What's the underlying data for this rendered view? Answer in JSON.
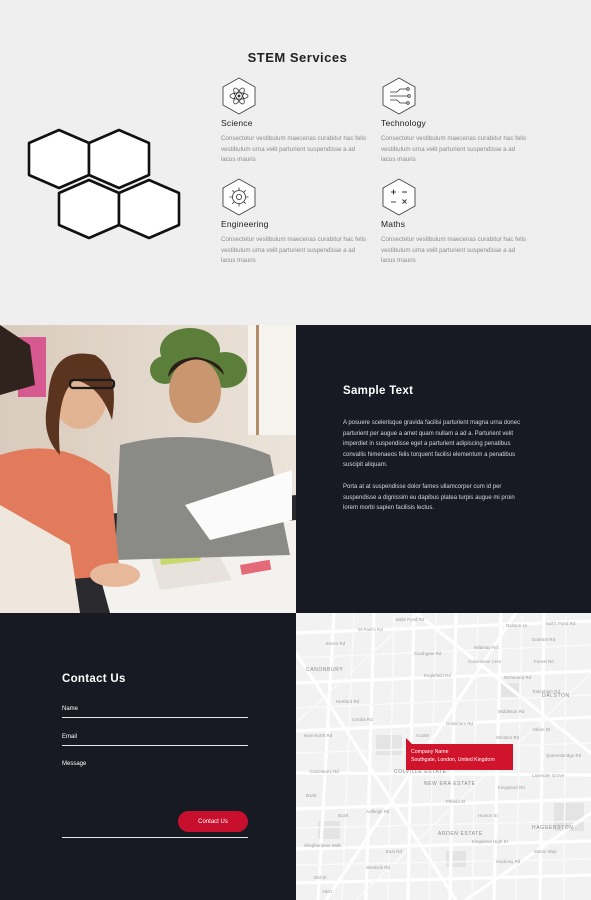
{
  "stem": {
    "title": "STEM Services",
    "services": [
      {
        "name": "Science",
        "icon": "atom-icon",
        "desc": "Consectetur vestibulum maecenas curabitur hac felis vestibulum urna velit parturient suspendisse a ad lacus mauris"
      },
      {
        "name": "Technology",
        "icon": "circuit-icon",
        "desc": "Consectetur vestibulum maecenas curabitur hac felis vestibulum urna velit parturient suspendisse a ad lacus mauris"
      },
      {
        "name": "Engineering",
        "icon": "gear-icon",
        "desc": "Consectetur vestibulum maecenas curabitur hac felis vestibulum urna velit parturient suspendisse a ad lacus mauris"
      },
      {
        "name": "Maths",
        "icon": "math-symbols-icon",
        "desc": "Consectetur vestibulum maecenas curabitur hac felis vestibulum urna velit parturient suspendisse a ad lacus mauris"
      }
    ]
  },
  "sample": {
    "title": "Sample Text",
    "paragraph1": "A posuere scelerisque gravida facilisi parturient magna urna donec parturient per augue a amet quam nullam a ad a. Parturient velit imperdiet in suspendisse eget a parturient adipiscing penatibus convallis himenaeos felis torquent facilisi elementum a penatibus suscipit aliquam.",
    "paragraph2": "Porta at at suspendisse dolor fames ullamcorper cum id per suspendisse a dignissim eu dapibus platea turpis augue mi proin lorem morbi sapien facilisis lectus."
  },
  "contact": {
    "title": "Contact Us",
    "name_label": "Name",
    "email_label": "Email",
    "message_label": "Message",
    "submit_label": "Contact Us"
  },
  "map": {
    "company_name": "Company Name",
    "company_address": "Southgate, London, United Kingdom",
    "areas": [
      "CANONBURY",
      "DALSTON",
      "COLVILLE ESTATE",
      "NEW ERA ESTATE",
      "HAGGERSTON",
      "ARDEN ESTATE"
    ],
    "streets": [
      "Balls Pond Rd",
      "Dalston Ln",
      "Essex Rd",
      "Englefield Rd",
      "Southgate Rd",
      "Downham Rd",
      "Kingsland Rd",
      "Richmond Rd",
      "Hertford Rd",
      "Middleton Rd",
      "Albion Dr",
      "Whiston Rd",
      "Hoxton St",
      "New North Rd",
      "Pitfield St",
      "East Rd",
      "Queensbridge Rd",
      "Forest Rd",
      "Lavender Grove",
      "Graham Rd",
      "Mildmay Rd",
      "Ardleigh Rd",
      "Canonbury Rd",
      "Colvestone Cres",
      "St Paul's Rd",
      "Hackney Rd",
      "Shepherdess Walk",
      "Wenlock Rd",
      "Old St",
      "B144",
      "A1209",
      "B108",
      "A10",
      "A501",
      "Kingsland High St",
      "Ball's Pond Rd",
      "Tottenham Rd",
      "Cecilia Rd",
      "Wilton Way"
    ]
  }
}
